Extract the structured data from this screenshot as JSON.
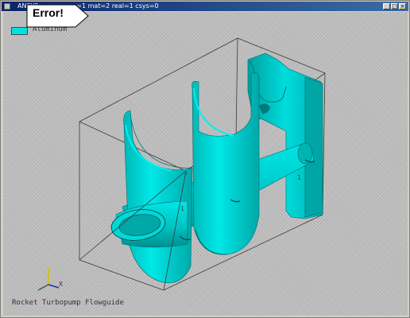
{
  "window": {
    "title": "ANSYS",
    "title_suffix": "ype=1 mat=2 real=1 csys=0",
    "minimize_label": "_",
    "maximize_label": "□",
    "close_label": "×"
  },
  "callout": {
    "text": "Error!"
  },
  "legend": {
    "label": "Aluminum",
    "color": "#00e0e0"
  },
  "model": {
    "caption": "Rocket Turbopump Flowguide",
    "part_color": "#00c8c8",
    "part_shadow_color": "#009a9a",
    "triad_axis_label": "X"
  }
}
